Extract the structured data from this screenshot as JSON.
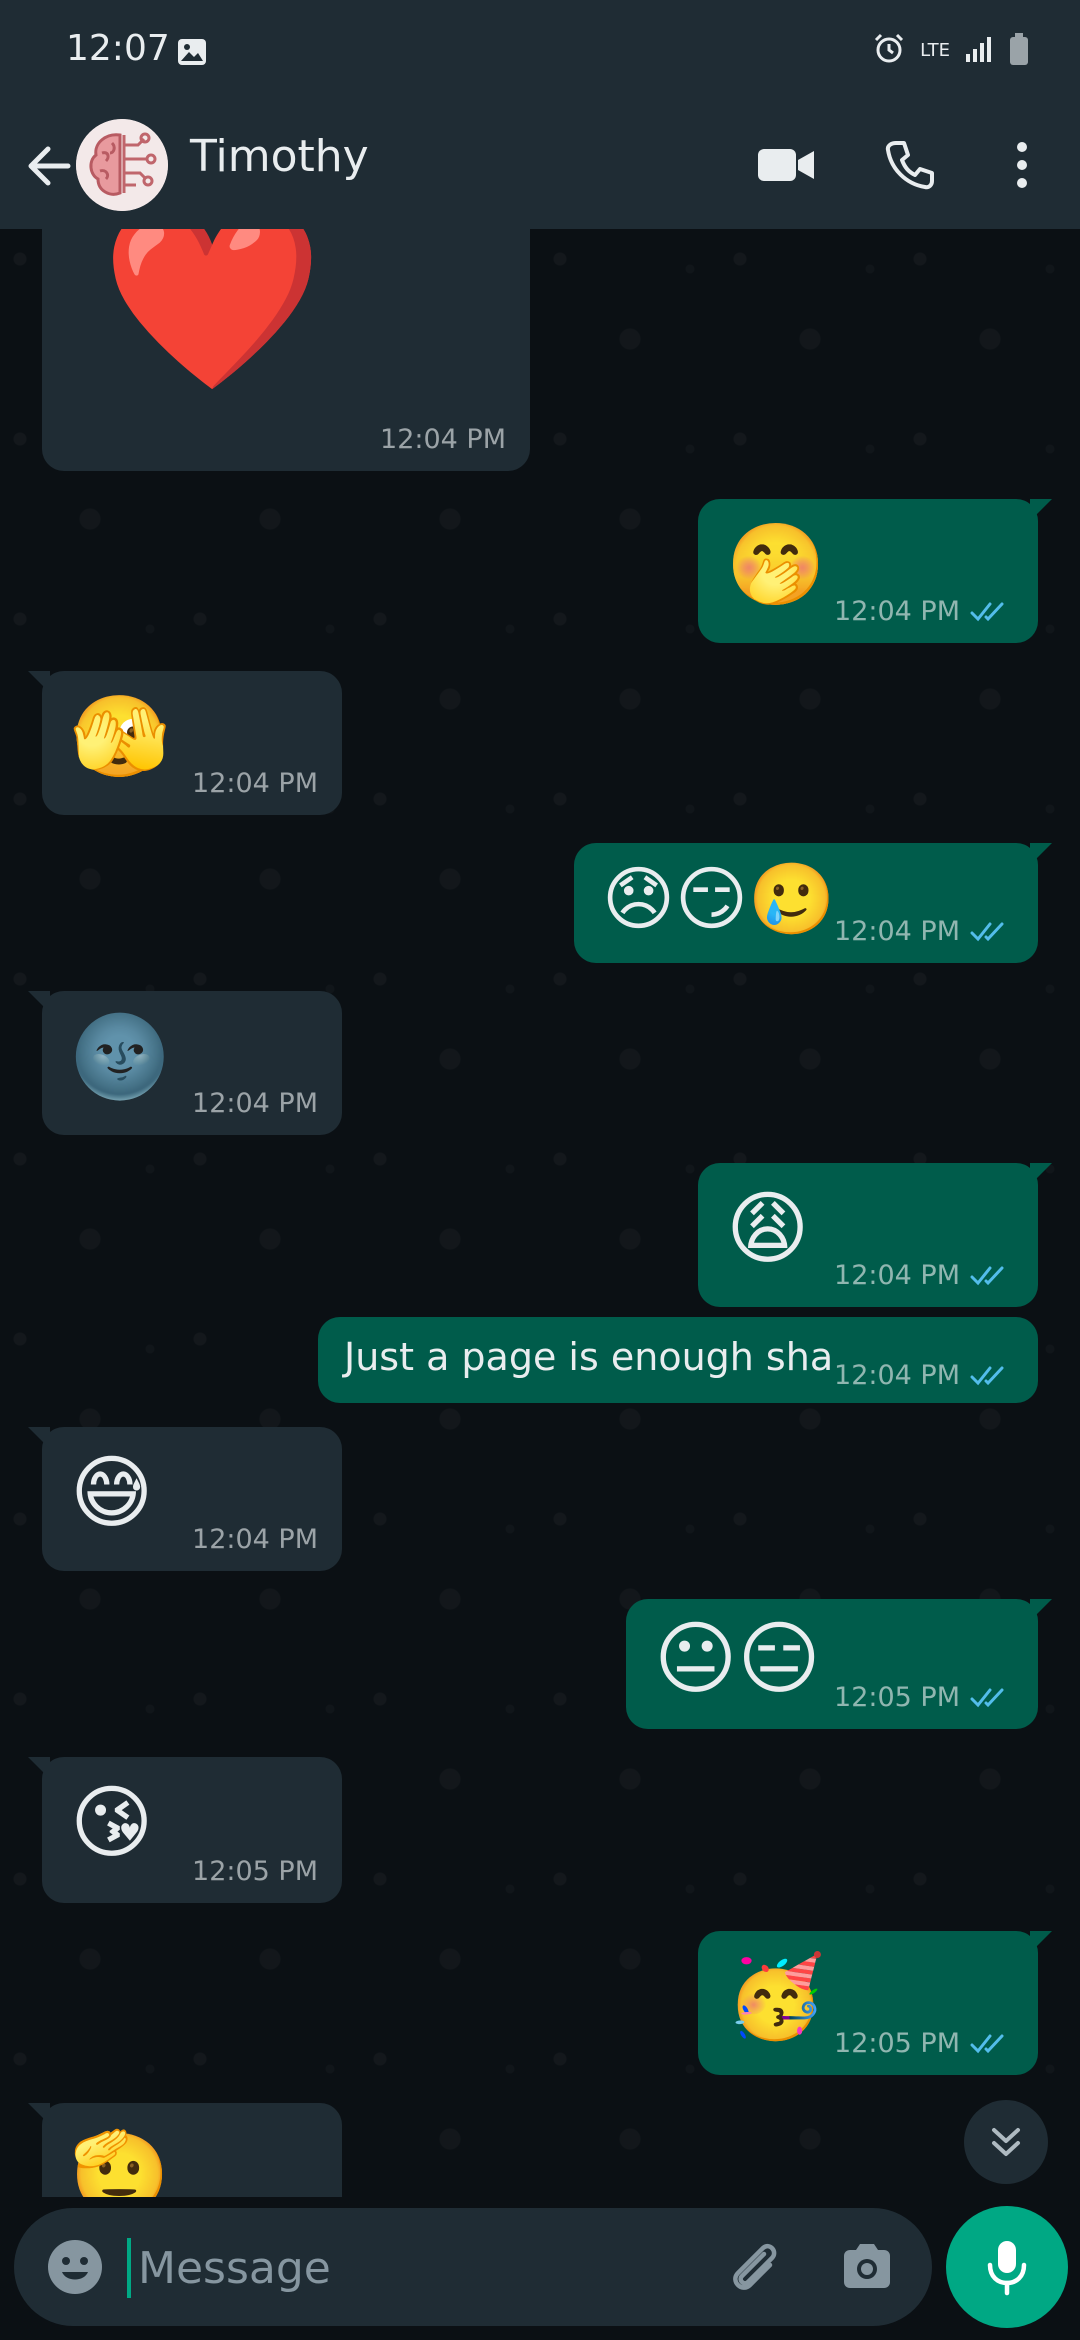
{
  "status_bar": {
    "time": "12:07",
    "network_label": "LTE"
  },
  "header": {
    "contact_name": "Timothy",
    "avatar_icon": "brain-icon"
  },
  "composer": {
    "placeholder": "Message",
    "value": ""
  },
  "messages": [
    {
      "direction": "in",
      "content": "❤️",
      "time": "12:04 PM"
    },
    {
      "direction": "out",
      "content": "🤭",
      "time": "12:04 PM",
      "read": true
    },
    {
      "direction": "in",
      "content": "🫣",
      "time": "12:04 PM"
    },
    {
      "direction": "out",
      "content": "😞😏🥲",
      "time": "12:04 PM",
      "read": true
    },
    {
      "direction": "in",
      "content": "🌚",
      "time": "12:04 PM"
    },
    {
      "direction": "out",
      "content": "😩",
      "time": "12:04 PM",
      "read": true
    },
    {
      "direction": "out",
      "content": "Just a page is enough sha",
      "time": "12:04 PM",
      "read": true
    },
    {
      "direction": "in",
      "content": "😅",
      "time": "12:04 PM"
    },
    {
      "direction": "out",
      "content": "😐😑",
      "time": "12:05 PM",
      "read": true
    },
    {
      "direction": "in",
      "content": "😘",
      "time": "12:05 PM"
    },
    {
      "direction": "out",
      "content": "🥳",
      "time": "12:05 PM",
      "read": true
    },
    {
      "direction": "in",
      "content": "🫡",
      "time": ""
    }
  ],
  "colors": {
    "header_bg": "#1f2c34",
    "chat_bg": "#0b1014",
    "incoming_bubble": "#1f2c34",
    "outgoing_bubble": "#005c4b",
    "accent": "#00a884",
    "read_tick": "#53bdeb"
  }
}
